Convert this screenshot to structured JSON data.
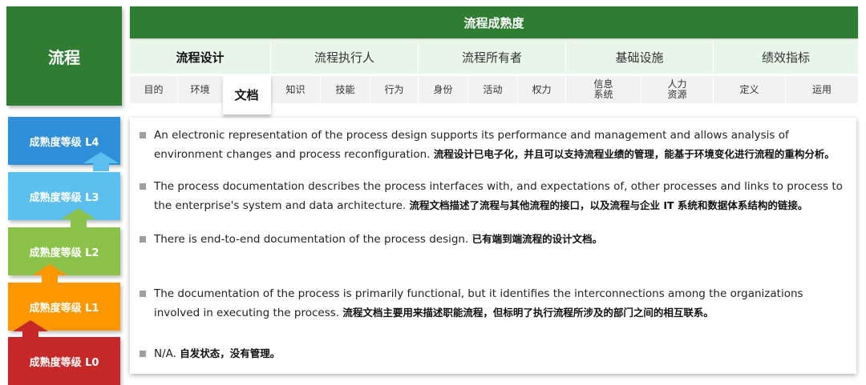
{
  "left_title": "流程",
  "header": {
    "title": "流程成熟度",
    "categories": [
      "流程设计",
      "流程执行人",
      "流程所有者",
      "基础设施",
      "绩效指标"
    ],
    "subitems": [
      "目的",
      "环境",
      "文档",
      "知识",
      "技能",
      "行为",
      "身份",
      "活动",
      "权力",
      "信息\n系统",
      "人力\n资源",
      "定义",
      "运用"
    ]
  },
  "levels": [
    {
      "label": "成熟度等级 L4",
      "color": "#2f8fd8"
    },
    {
      "label": "成熟度等级 L3",
      "color": "#5bc0f0"
    },
    {
      "label": "成熟度等级 L2",
      "color": "#8bc34a"
    },
    {
      "label": "成熟度等级 L1",
      "color": "#ff9800"
    },
    {
      "label": "成熟度等级 L0",
      "color": "#c62828"
    }
  ],
  "rows": [
    {
      "en": "An electronic  representation of the process design supports its performance and management and allows analysis of environment changes and process reconfiguration.",
      "zh": "流程设计已电子化，并且可以支持流程业绩的管理，能基于环境变化进行流程的重构分析。"
    },
    {
      "en": "The process documentation describes the process interfaces with, and expectations of, other processes and links to process to the enterprise's system and data architecture.",
      "zh": "流程文档描述了流程与其他流程的接口，以及流程与企业 IT  系统和数据体系结构的链接。"
    },
    {
      "en": "There is end-to-end documentation of the process design.",
      "zh": "已有端到端流程的设计文档。"
    },
    {
      "en": "The documentation of the process is primarily functional, but it identifies the interconnections among the organizations involved in executing the process.",
      "zh": "流程文档主要用来描述职能流程，但标明了执行流程所涉及的部门之间的相互联系。"
    },
    {
      "en": "N/A.",
      "zh": "自发状态，没有管理。"
    }
  ]
}
